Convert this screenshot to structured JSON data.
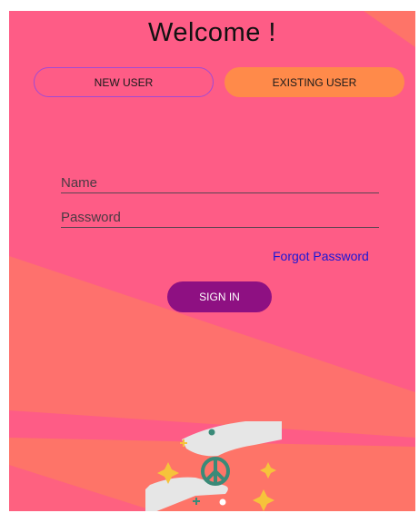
{
  "header": {
    "title": "Welcome !"
  },
  "tabs": {
    "new_user": "NEW USER",
    "existing_user": "EXISTING USER",
    "active": "EXISTING USER"
  },
  "form": {
    "name_placeholder": "Name",
    "password_placeholder": "Password",
    "forgot_password": "Forgot Password",
    "sign_in": "SIGN IN"
  },
  "colors": {
    "background_pink": "#fe5c86",
    "background_coral": "#fe7468",
    "active_tab": "#ff8a4a",
    "inactive_tab_border": "#a24ad3",
    "sign_in_button": "#8e1082",
    "link": "#1a17d6"
  },
  "illustration": {
    "icon": "peace-hands-icon"
  }
}
